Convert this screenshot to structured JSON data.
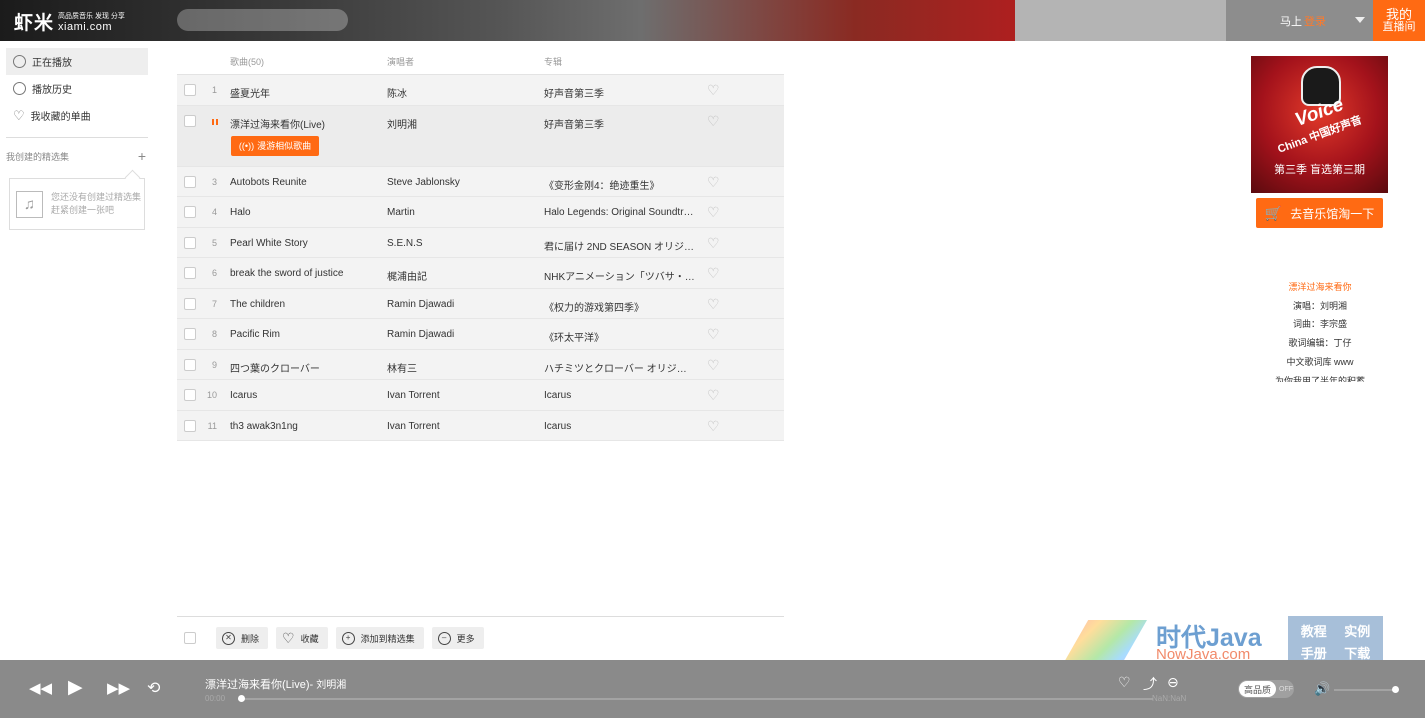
{
  "header": {
    "logo_cn": "虾米",
    "logo_tag": "高品质音乐 发现 分享",
    "logo_en": "xiami.com",
    "search_placeholder": "",
    "user_prefix": "马上",
    "user_login": "登录",
    "live_line1": "我的",
    "live_line2": "直播间"
  },
  "sidebar": {
    "items": [
      {
        "label": "正在播放",
        "icon": "disc-icon",
        "active": true
      },
      {
        "label": "播放历史",
        "icon": "clock-icon",
        "active": false
      },
      {
        "label": "我收藏的单曲",
        "icon": "heart-icon",
        "active": false
      }
    ],
    "collections_title": "我创建的精选集",
    "add_icon": "plus-icon",
    "empty_line1": "您还没有创建过精选集",
    "empty_line2": "赶紧创建一张吧"
  },
  "list": {
    "headers": {
      "title": "歌曲(50)",
      "artist": "演唱者",
      "album": "专辑"
    },
    "similar_label": "漫游相似歌曲",
    "rows": [
      {
        "num": "1",
        "title": "盛夏光年",
        "artist": "陈冰",
        "album": "好声音第三季"
      },
      {
        "num": "",
        "title": "漂洋过海来看你(Live)",
        "artist": "刘明湘",
        "album": "好声音第三季",
        "playing": true
      },
      {
        "num": "3",
        "title": "Autobots Reunite",
        "artist": "Steve Jablonsky",
        "album": "《变形金刚4：绝迹重生》"
      },
      {
        "num": "4",
        "title": "Halo",
        "artist": "Martin",
        "album": "Halo Legends: Original Soundtrack"
      },
      {
        "num": "5",
        "title": "Pearl White Story",
        "artist": "S.E.N.S",
        "album": "君に届け 2ND SEASON オリジナル・"
      },
      {
        "num": "6",
        "title": "break the sword of justice",
        "artist": "梶浦由記",
        "album": "NHKアニメーション「ツバサ・クロニ"
      },
      {
        "num": "7",
        "title": "The children",
        "artist": "Ramin Djawadi",
        "album": "《权力的游戏第四季》"
      },
      {
        "num": "8",
        "title": "Pacific Rim",
        "artist": "Ramin Djawadi",
        "album": "《环太平洋》"
      },
      {
        "num": "9",
        "title": "四つ葉のクローバー",
        "artist": "林有三",
        "album": "ハチミツとクローバー オリジナルサウ"
      },
      {
        "num": "10",
        "title": "Icarus",
        "artist": "Ivan Torrent",
        "album": "Icarus"
      },
      {
        "num": "11",
        "title": "th3 awak3n1ng",
        "artist": "Ivan Torrent",
        "album": "Icarus"
      }
    ]
  },
  "toolbar": {
    "delete": "删除",
    "collect": "收藏",
    "add_to": "添加到精选集",
    "more": "更多"
  },
  "right": {
    "cover_voice": "Voice",
    "cover_china": "China 中国好声音",
    "cover_caption": "第三季 盲选第三期",
    "buy_label": "去音乐馆淘一下",
    "lyrics": [
      "漂洋过海来看你",
      "演唱：刘明湘",
      "词曲：李宗盛",
      "歌词编辑：丁仔",
      "中文歌词库 www",
      "为你我用了半年的积蓄"
    ]
  },
  "watermark": {
    "line1": "时代Java",
    "line2": "NowJava.com",
    "b1": "教程",
    "b2": "实例",
    "b3": "手册",
    "b4": "下载"
  },
  "player": {
    "song": "漂洋过海来看你(Live)-",
    "artist": "刘明湘",
    "time_current": "00:00",
    "time_total": "NaN:NaN",
    "progress": 0,
    "hq_on": "高品质",
    "hq_off": "OFF",
    "volume": 1.0
  },
  "colors": {
    "accent": "#ff6a13",
    "player_bg": "#8a8a8a"
  }
}
